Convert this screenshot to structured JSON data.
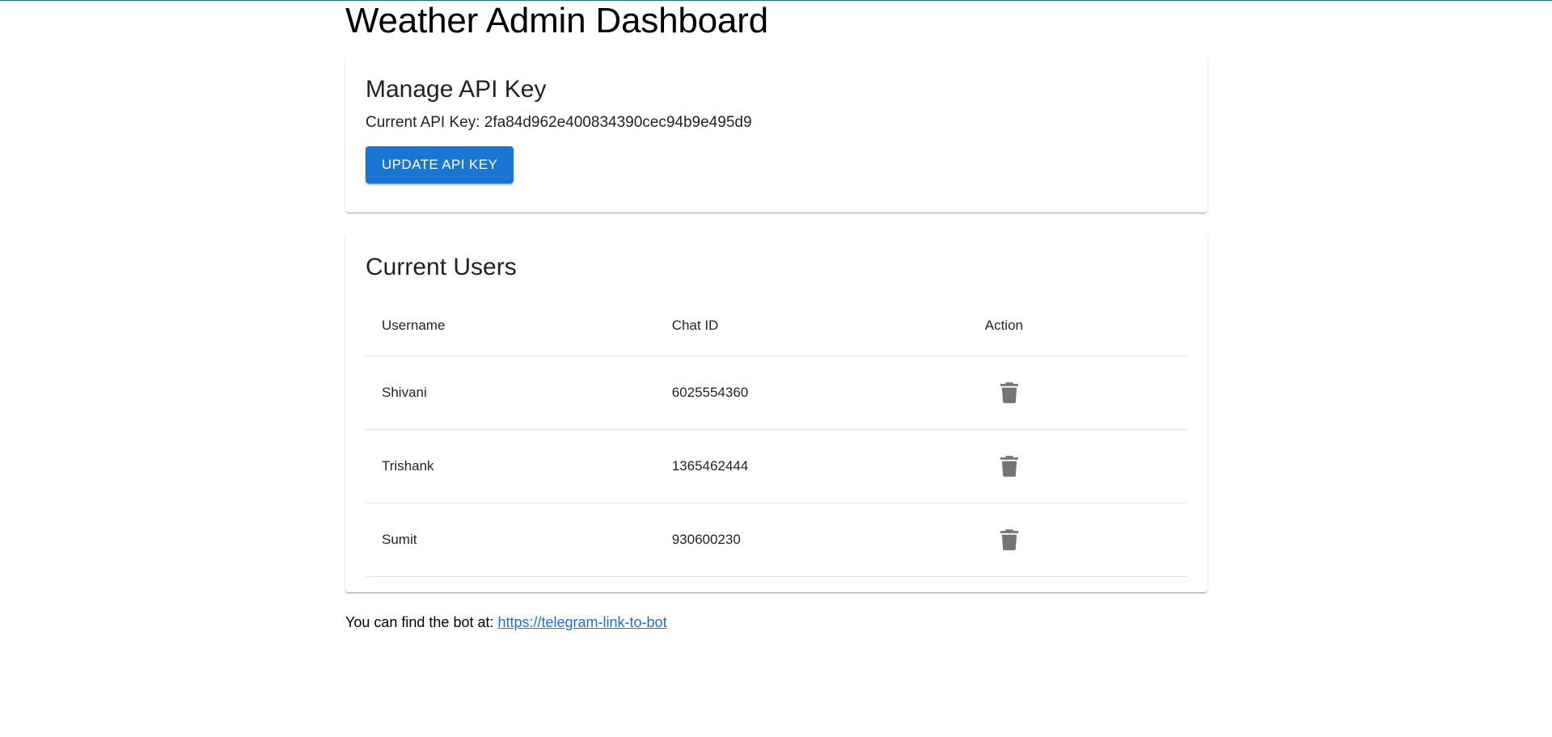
{
  "page": {
    "title": "Weather Admin Dashboard"
  },
  "api_card": {
    "title": "Manage API Key",
    "key_label": "Current API Key: ",
    "key_value": "2fa84d962e400834390cec94b9e495d9",
    "update_button": "UPDATE API KEY"
  },
  "users_card": {
    "title": "Current Users",
    "headers": {
      "username": "Username",
      "chat_id": "Chat ID",
      "action": "Action"
    },
    "rows": [
      {
        "username": "Shivani",
        "chat_id": "6025554360",
        "action_icon": "trash-icon"
      },
      {
        "username": "Trishank",
        "chat_id": "1365462444",
        "action_icon": "trash-icon"
      },
      {
        "username": "Sumit",
        "chat_id": "930600230",
        "action_icon": "trash-icon"
      }
    ]
  },
  "footer": {
    "text": "You can find the bot at: ",
    "link_text": "https://telegram-link-to-bot"
  },
  "colors": {
    "primary": "#1976d2",
    "link": "#1f6fd0",
    "icon": "#757575",
    "divider": "#e0e0e0"
  }
}
